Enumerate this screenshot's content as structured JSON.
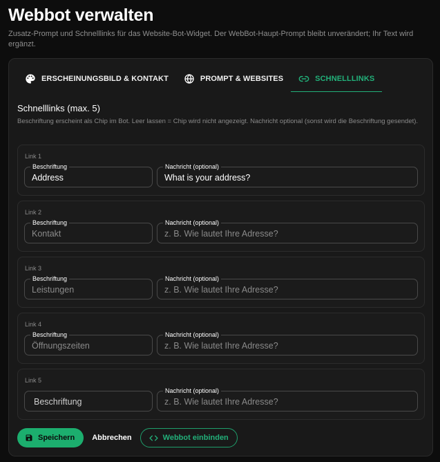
{
  "header": {
    "title": "Webbot verwalten",
    "subtitle": "Zusatz-Prompt und Schnelllinks für das Website-Bot-Widget. Der WebBot-Haupt-Prompt bleibt unverändert; Ihr Text wird ergänzt."
  },
  "tabs": [
    {
      "label": "ERSCHEINUNGSBILD & KONTAKT",
      "icon": "palette-icon",
      "active": false
    },
    {
      "label": "PROMPT & WEBSITES",
      "icon": "globe-icon",
      "active": false
    },
    {
      "label": "SCHNELLLINKS",
      "icon": "link-icon",
      "active": true
    }
  ],
  "section": {
    "title": "Schnelllinks (max. 5)",
    "hint": "Beschriftung erscheint als Chip im Bot. Leer lassen = Chip wird nicht angezeigt. Nachricht optional (sonst wird die Beschriftung gesendet)."
  },
  "links": [
    {
      "label": "Link 1",
      "caption_legend": "Beschriftung",
      "caption_value": "Address",
      "caption_placeholder": "",
      "message_legend": "Nachricht (optional)",
      "message_value": "What is your address?",
      "message_placeholder": ""
    },
    {
      "label": "Link 2",
      "caption_legend": "Beschriftung",
      "caption_value": "",
      "caption_placeholder": "Kontakt",
      "message_legend": "Nachricht (optional)",
      "message_value": "",
      "message_placeholder": "z. B. Wie lautet Ihre Adresse?"
    },
    {
      "label": "Link 3",
      "caption_legend": "Beschriftung",
      "caption_value": "",
      "caption_placeholder": "Leistungen",
      "message_legend": "Nachricht (optional)",
      "message_value": "",
      "message_placeholder": "z. B. Wie lautet Ihre Adresse?"
    },
    {
      "label": "Link 4",
      "caption_legend": "Beschriftung",
      "caption_value": "",
      "caption_placeholder": "Öffnungszeiten",
      "message_legend": "Nachricht (optional)",
      "message_value": "",
      "message_placeholder": "z. B. Wie lautet Ihre Adresse?"
    },
    {
      "label": "Link 5",
      "caption_legend": "",
      "caption_value": "",
      "caption_placeholder": "Beschriftung",
      "message_legend": "Nachricht (optional)",
      "message_value": "",
      "message_placeholder": "z. B. Wie lautet Ihre Adresse?"
    }
  ],
  "actions": {
    "save_label": "Speichern",
    "cancel_label": "Abbrechen",
    "embed_label": "Webbot einbinden"
  },
  "colors": {
    "accent": "#1cae6e",
    "background": "#0d0d0d",
    "card": "#191919"
  }
}
